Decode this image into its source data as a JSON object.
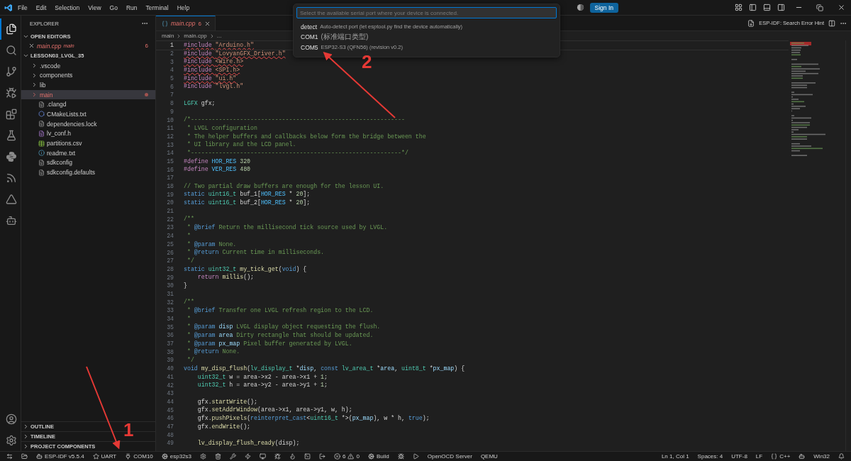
{
  "menu": [
    "File",
    "Edit",
    "Selection",
    "View",
    "Go",
    "Run",
    "Terminal",
    "Help"
  ],
  "sign_in": "Sign In",
  "quick_pick": {
    "placeholder": "Select the available serial port where your device is connected.",
    "items": [
      {
        "label": "detect",
        "description": "Auto-detect port (let esptool.py find the device automatically)",
        "selected": false
      },
      {
        "label": "COM1",
        "description": "(标准端口类型)",
        "selected": false
      },
      {
        "label": "COM5",
        "description": "ESP32-S3 (QFN56) (revision v0.2)",
        "selected": false
      }
    ]
  },
  "activity_bar": [
    {
      "kind": "explorer",
      "selected": true
    },
    {
      "kind": "search",
      "selected": false
    },
    {
      "kind": "source-control",
      "selected": false
    },
    {
      "kind": "run-debug",
      "selected": false
    },
    {
      "kind": "extensions",
      "selected": false
    },
    {
      "kind": "testing",
      "selected": false
    },
    {
      "kind": "python",
      "selected": false
    },
    {
      "kind": "esp-idf",
      "selected": false
    },
    {
      "kind": "triangle",
      "selected": false
    },
    {
      "kind": "bot",
      "selected": false
    }
  ],
  "sidebar": {
    "title": "EXPLORER",
    "open_editors": {
      "label": "OPEN EDITORS",
      "expanded": true,
      "items": [
        {
          "label": "main.cpp",
          "folder": "main",
          "count": "6"
        }
      ]
    },
    "project": {
      "label": "LESSON03_LVGL_35",
      "expanded": true,
      "children": [
        {
          "label": ".vscode",
          "kind": "folder",
          "expanded": false,
          "selected": false,
          "modified": false
        },
        {
          "label": "components",
          "kind": "folder",
          "expanded": false,
          "selected": false,
          "modified": false
        },
        {
          "label": "lib",
          "kind": "folder",
          "expanded": false,
          "selected": false,
          "modified": false
        },
        {
          "label": "main",
          "kind": "folder",
          "expanded": false,
          "selected": true,
          "modified": true
        },
        {
          "label": ".clangd",
          "kind": "plain",
          "selected": false,
          "modified": false
        },
        {
          "label": "CMakeLists.txt",
          "kind": "cmake",
          "selected": false,
          "modified": false
        },
        {
          "label": "dependencies.lock",
          "kind": "plain",
          "selected": false,
          "modified": false
        },
        {
          "label": "lv_conf.h",
          "kind": "header",
          "selected": false,
          "modified": false
        },
        {
          "label": "partitions.csv",
          "kind": "table",
          "selected": false,
          "modified": false
        },
        {
          "label": "readme.txt",
          "kind": "info",
          "selected": false,
          "modified": false
        },
        {
          "label": "sdkconfig",
          "kind": "plain",
          "selected": false,
          "modified": false
        },
        {
          "label": "sdkconfig.defaults",
          "kind": "plain",
          "selected": false,
          "modified": false
        }
      ]
    },
    "sections": [
      {
        "label": "OUTLINE",
        "expanded": false
      },
      {
        "label": "TIMELINE",
        "expanded": false
      },
      {
        "label": "PROJECT COMPONENTS",
        "expanded": false
      }
    ]
  },
  "tabs": [
    {
      "label": "main.cpp",
      "count": "6",
      "selected": true
    }
  ],
  "editor_action": "ESP-IDF: Search Error Hint",
  "breadcrumb": [
    "main",
    "main.cpp",
    "..."
  ],
  "code": [
    {
      "n": "1",
      "error": true,
      "current": true,
      "tokens": [
        {
          "text": "#include ",
          "kind": "pp"
        },
        {
          "text": "\"Arduino.h\"",
          "kind": "str"
        }
      ]
    },
    {
      "n": "2",
      "error": true,
      "current": false,
      "tokens": [
        {
          "text": "#include ",
          "kind": "pp"
        },
        {
          "text": "\"LovyanGFX_Driver.h\"",
          "kind": "str"
        }
      ]
    },
    {
      "n": "3",
      "error": true,
      "current": false,
      "tokens": [
        {
          "text": "#include ",
          "kind": "pp"
        },
        {
          "text": "<Wire.h>",
          "kind": "str"
        }
      ]
    },
    {
      "n": "4",
      "error": true,
      "current": false,
      "tokens": [
        {
          "text": "#include ",
          "kind": "pp"
        },
        {
          "text": "<SPI.h>",
          "kind": "str"
        }
      ]
    },
    {
      "n": "5",
      "error": true,
      "current": false,
      "tokens": [
        {
          "text": "#include ",
          "kind": "pp"
        },
        {
          "text": "\"ui.h\"",
          "kind": "str"
        }
      ]
    },
    {
      "n": "6",
      "error": false,
      "current": false,
      "tokens": [
        {
          "text": "#include ",
          "kind": "pp"
        },
        {
          "text": "\"lvgl.h\"",
          "kind": "str"
        }
      ]
    },
    {
      "n": "7",
      "error": false,
      "current": false
    },
    {
      "n": "8",
      "error": false,
      "current": false,
      "tokens": [
        {
          "text": "LGFX",
          "kind": "type"
        },
        {
          "text": " gfx;",
          "kind": "pl"
        }
      ]
    },
    {
      "n": "9",
      "error": false,
      "current": false
    },
    {
      "n": "10",
      "error": false,
      "current": false,
      "tokens": [
        {
          "text": "/*-------------------------------------------------------------",
          "kind": "cmt"
        }
      ]
    },
    {
      "n": "11",
      "error": false,
      "current": false,
      "tokens": [
        {
          "text": " * LVGL configuration",
          "kind": "cmt"
        }
      ]
    },
    {
      "n": "12",
      "error": false,
      "current": false,
      "tokens": [
        {
          "text": " * The helper buffers and callbacks below form the bridge between the",
          "kind": "cmt"
        }
      ]
    },
    {
      "n": "13",
      "error": false,
      "current": false,
      "tokens": [
        {
          "text": " * UI library and the LCD panel.",
          "kind": "cmt"
        }
      ]
    },
    {
      "n": "14",
      "error": false,
      "current": false,
      "tokens": [
        {
          "text": " *------------------------------------------------------------*/",
          "kind": "cmt"
        }
      ]
    },
    {
      "n": "15",
      "error": false,
      "current": false,
      "tokens": [
        {
          "text": "#define ",
          "kind": "pp"
        },
        {
          "text": "HOR_RES",
          "kind": "mac"
        },
        {
          "text": " 320",
          "kind": "num"
        }
      ]
    },
    {
      "n": "16",
      "error": false,
      "current": false,
      "tokens": [
        {
          "text": "#define ",
          "kind": "pp"
        },
        {
          "text": "VER_RES",
          "kind": "mac"
        },
        {
          "text": " 480",
          "kind": "num"
        }
      ]
    },
    {
      "n": "17",
      "error": false,
      "current": false
    },
    {
      "n": "18",
      "error": false,
      "current": false,
      "tokens": [
        {
          "text": "// Two partial draw buffers are enough for the lesson UI.",
          "kind": "cmt"
        }
      ]
    },
    {
      "n": "19",
      "error": false,
      "current": false,
      "tokens": [
        {
          "text": "static ",
          "kind": "kw"
        },
        {
          "text": "uint16_t",
          "kind": "type"
        },
        {
          "text": " buf_1[",
          "kind": "pl"
        },
        {
          "text": "HOR_RES",
          "kind": "mac"
        },
        {
          "text": " * ",
          "kind": "pl"
        },
        {
          "text": "20",
          "kind": "num"
        },
        {
          "text": "];",
          "kind": "pl"
        }
      ]
    },
    {
      "n": "20",
      "error": false,
      "current": false,
      "tokens": [
        {
          "text": "static ",
          "kind": "kw"
        },
        {
          "text": "uint16_t",
          "kind": "type"
        },
        {
          "text": " buf_2[",
          "kind": "pl"
        },
        {
          "text": "HOR_RES",
          "kind": "mac"
        },
        {
          "text": " * ",
          "kind": "pl"
        },
        {
          "text": "20",
          "kind": "num"
        },
        {
          "text": "];",
          "kind": "pl"
        }
      ]
    },
    {
      "n": "21",
      "error": false,
      "current": false
    },
    {
      "n": "22",
      "error": false,
      "current": false,
      "tokens": [
        {
          "text": "/**",
          "kind": "cmt"
        }
      ]
    },
    {
      "n": "23",
      "error": false,
      "current": false,
      "tokens": [
        {
          "text": " * ",
          "kind": "cmt"
        },
        {
          "text": "@brief",
          "kind": "tag"
        },
        {
          "text": " Return the millisecond tick source used by LVGL.",
          "kind": "cmt"
        }
      ]
    },
    {
      "n": "24",
      "error": false,
      "current": false,
      "tokens": [
        {
          "text": " *",
          "kind": "cmt"
        }
      ]
    },
    {
      "n": "25",
      "error": false,
      "current": false,
      "tokens": [
        {
          "text": " * ",
          "kind": "cmt"
        },
        {
          "text": "@param",
          "kind": "tag"
        },
        {
          "text": " None.",
          "kind": "cmt"
        }
      ]
    },
    {
      "n": "26",
      "error": false,
      "current": false,
      "tokens": [
        {
          "text": " * ",
          "kind": "cmt"
        },
        {
          "text": "@return",
          "kind": "tag"
        },
        {
          "text": " Current time in milliseconds.",
          "kind": "cmt"
        }
      ]
    },
    {
      "n": "27",
      "error": false,
      "current": false,
      "tokens": [
        {
          "text": " */",
          "kind": "cmt"
        }
      ]
    },
    {
      "n": "28",
      "error": false,
      "current": false,
      "tokens": [
        {
          "text": "static ",
          "kind": "kw"
        },
        {
          "text": "uint32_t",
          "kind": "type"
        },
        {
          "text": " my_tick_get",
          "kind": "fn"
        },
        {
          "text": "(",
          "kind": "pl"
        },
        {
          "text": "void",
          "kind": "kw"
        },
        {
          "text": ") {",
          "kind": "pl"
        }
      ]
    },
    {
      "n": "29",
      "error": false,
      "current": false,
      "tokens": [
        {
          "text": "    return ",
          "kind": "pp"
        },
        {
          "text": "millis",
          "kind": "fn"
        },
        {
          "text": "();",
          "kind": "pl"
        }
      ]
    },
    {
      "n": "30",
      "error": false,
      "current": false,
      "tokens": [
        {
          "text": "}",
          "kind": "pl"
        }
      ]
    },
    {
      "n": "31",
      "error": false,
      "current": false
    },
    {
      "n": "32",
      "error": false,
      "current": false,
      "tokens": [
        {
          "text": "/**",
          "kind": "cmt"
        }
      ]
    },
    {
      "n": "33",
      "error": false,
      "current": false,
      "tokens": [
        {
          "text": " * ",
          "kind": "cmt"
        },
        {
          "text": "@brief",
          "kind": "tag"
        },
        {
          "text": " Transfer one LVGL refresh region to the LCD.",
          "kind": "cmt"
        }
      ]
    },
    {
      "n": "34",
      "error": false,
      "current": false,
      "tokens": [
        {
          "text": " *",
          "kind": "cmt"
        }
      ]
    },
    {
      "n": "35",
      "error": false,
      "current": false,
      "tokens": [
        {
          "text": " * ",
          "kind": "cmt"
        },
        {
          "text": "@param",
          "kind": "tag"
        },
        {
          "text": " disp",
          "kind": "var"
        },
        {
          "text": " LVGL display object requesting the flush.",
          "kind": "cmt"
        }
      ]
    },
    {
      "n": "36",
      "error": false,
      "current": false,
      "tokens": [
        {
          "text": " * ",
          "kind": "cmt"
        },
        {
          "text": "@param",
          "kind": "tag"
        },
        {
          "text": " area",
          "kind": "var"
        },
        {
          "text": " Dirty rectangle that should be updated.",
          "kind": "cmt"
        }
      ]
    },
    {
      "n": "37",
      "error": false,
      "current": false,
      "tokens": [
        {
          "text": " * ",
          "kind": "cmt"
        },
        {
          "text": "@param",
          "kind": "tag"
        },
        {
          "text": " px_map",
          "kind": "var"
        },
        {
          "text": " Pixel buffer generated by LVGL.",
          "kind": "cmt"
        }
      ]
    },
    {
      "n": "38",
      "error": false,
      "current": false,
      "tokens": [
        {
          "text": " * ",
          "kind": "cmt"
        },
        {
          "text": "@return",
          "kind": "tag"
        },
        {
          "text": " None.",
          "kind": "cmt"
        }
      ]
    },
    {
      "n": "39",
      "error": false,
      "current": false,
      "tokens": [
        {
          "text": " */",
          "kind": "cmt"
        }
      ]
    },
    {
      "n": "40",
      "error": false,
      "current": false,
      "tokens": [
        {
          "text": "void ",
          "kind": "kw"
        },
        {
          "text": "my_disp_flush",
          "kind": "fn"
        },
        {
          "text": "(",
          "kind": "pl"
        },
        {
          "text": "lv_display_t",
          "kind": "type"
        },
        {
          "text": " *",
          "kind": "pl"
        },
        {
          "text": "disp",
          "kind": "var"
        },
        {
          "text": ", ",
          "kind": "pl"
        },
        {
          "text": "const ",
          "kind": "kw"
        },
        {
          "text": "lv_area_t",
          "kind": "type"
        },
        {
          "text": " *",
          "kind": "pl"
        },
        {
          "text": "area",
          "kind": "var"
        },
        {
          "text": ", ",
          "kind": "pl"
        },
        {
          "text": "uint8_t",
          "kind": "type"
        },
        {
          "text": " *",
          "kind": "pl"
        },
        {
          "text": "px_map",
          "kind": "var"
        },
        {
          "text": ") {",
          "kind": "pl"
        }
      ]
    },
    {
      "n": "41",
      "error": false,
      "current": false,
      "tokens": [
        {
          "text": "    uint32_t",
          "kind": "type"
        },
        {
          "text": " w = area->x2 - area->x1 + ",
          "kind": "pl"
        },
        {
          "text": "1",
          "kind": "num"
        },
        {
          "text": ";",
          "kind": "pl"
        }
      ]
    },
    {
      "n": "42",
      "error": false,
      "current": false,
      "tokens": [
        {
          "text": "    uint32_t",
          "kind": "type"
        },
        {
          "text": " h = area->y2 - area->y1 + ",
          "kind": "pl"
        },
        {
          "text": "1",
          "kind": "num"
        },
        {
          "text": ";",
          "kind": "pl"
        }
      ]
    },
    {
      "n": "43",
      "error": false,
      "current": false
    },
    {
      "n": "44",
      "error": false,
      "current": false,
      "tokens": [
        {
          "text": "    gfx.",
          "kind": "pl"
        },
        {
          "text": "startWrite",
          "kind": "fn"
        },
        {
          "text": "();",
          "kind": "pl"
        }
      ]
    },
    {
      "n": "45",
      "error": false,
      "current": false,
      "tokens": [
        {
          "text": "    gfx.",
          "kind": "pl"
        },
        {
          "text": "setAddrWindow",
          "kind": "fn"
        },
        {
          "text": "(area->x1, area->y1, w, h);",
          "kind": "pl"
        }
      ]
    },
    {
      "n": "46",
      "error": false,
      "current": false,
      "tokens": [
        {
          "text": "    gfx.",
          "kind": "pl"
        },
        {
          "text": "pushPixels",
          "kind": "fn"
        },
        {
          "text": "(",
          "kind": "pl"
        },
        {
          "text": "reinterpret_cast",
          "kind": "kw"
        },
        {
          "text": "<",
          "kind": "pl"
        },
        {
          "text": "uint16_t",
          "kind": "type"
        },
        {
          "text": " *>(",
          "kind": "pl"
        },
        {
          "text": "px_map",
          "kind": "var"
        },
        {
          "text": "), w * h, ",
          "kind": "pl"
        },
        {
          "text": "true",
          "kind": "kw"
        },
        {
          "text": ");",
          "kind": "pl"
        }
      ]
    },
    {
      "n": "47",
      "error": false,
      "current": false,
      "tokens": [
        {
          "text": "    gfx.",
          "kind": "pl"
        },
        {
          "text": "endWrite",
          "kind": "fn"
        },
        {
          "text": "();",
          "kind": "pl"
        }
      ]
    },
    {
      "n": "48",
      "error": false,
      "current": false
    },
    {
      "n": "49",
      "error": false,
      "current": false,
      "tokens": [
        {
          "text": "    lv_display_flush_ready",
          "kind": "fn"
        },
        {
          "text": "(disp);",
          "kind": "pl"
        }
      ]
    }
  ],
  "status_left": [
    {
      "kind": "remote"
    },
    {
      "kind": "folder"
    },
    {
      "kind": "idf",
      "label": "ESP-IDF v5.5.4"
    },
    {
      "kind": "uart",
      "label": "UART"
    },
    {
      "kind": "port",
      "label": "COM10"
    },
    {
      "kind": "target",
      "label": "esp32s3"
    },
    {
      "kind": "settings"
    },
    {
      "kind": "trash"
    },
    {
      "kind": "wrench"
    },
    {
      "kind": "flash"
    },
    {
      "kind": "monitor"
    },
    {
      "kind": "debug"
    },
    {
      "kind": "flame"
    },
    {
      "kind": "terminal"
    },
    {
      "kind": "export"
    },
    {
      "kind": "problems",
      "errors": "6",
      "warnings": "0"
    },
    {
      "kind": "build",
      "label": "Build"
    },
    {
      "kind": "bug"
    },
    {
      "kind": "run"
    },
    {
      "kind": "text",
      "label": "OpenOCD Server"
    },
    {
      "kind": "text",
      "label": "QEMU"
    }
  ],
  "status_right": [
    {
      "kind": "text",
      "label": "Ln 1, Col 1"
    },
    {
      "kind": "text",
      "label": "Spaces: 4"
    },
    {
      "kind": "text",
      "label": "UTF-8"
    },
    {
      "kind": "text",
      "label": "LF"
    },
    {
      "kind": "language",
      "label": "C++"
    },
    {
      "kind": "copilot"
    },
    {
      "kind": "text",
      "label": "Win32"
    },
    {
      "kind": "bell"
    }
  ],
  "annotations": [
    {
      "label": "1"
    },
    {
      "label": "2"
    }
  ]
}
